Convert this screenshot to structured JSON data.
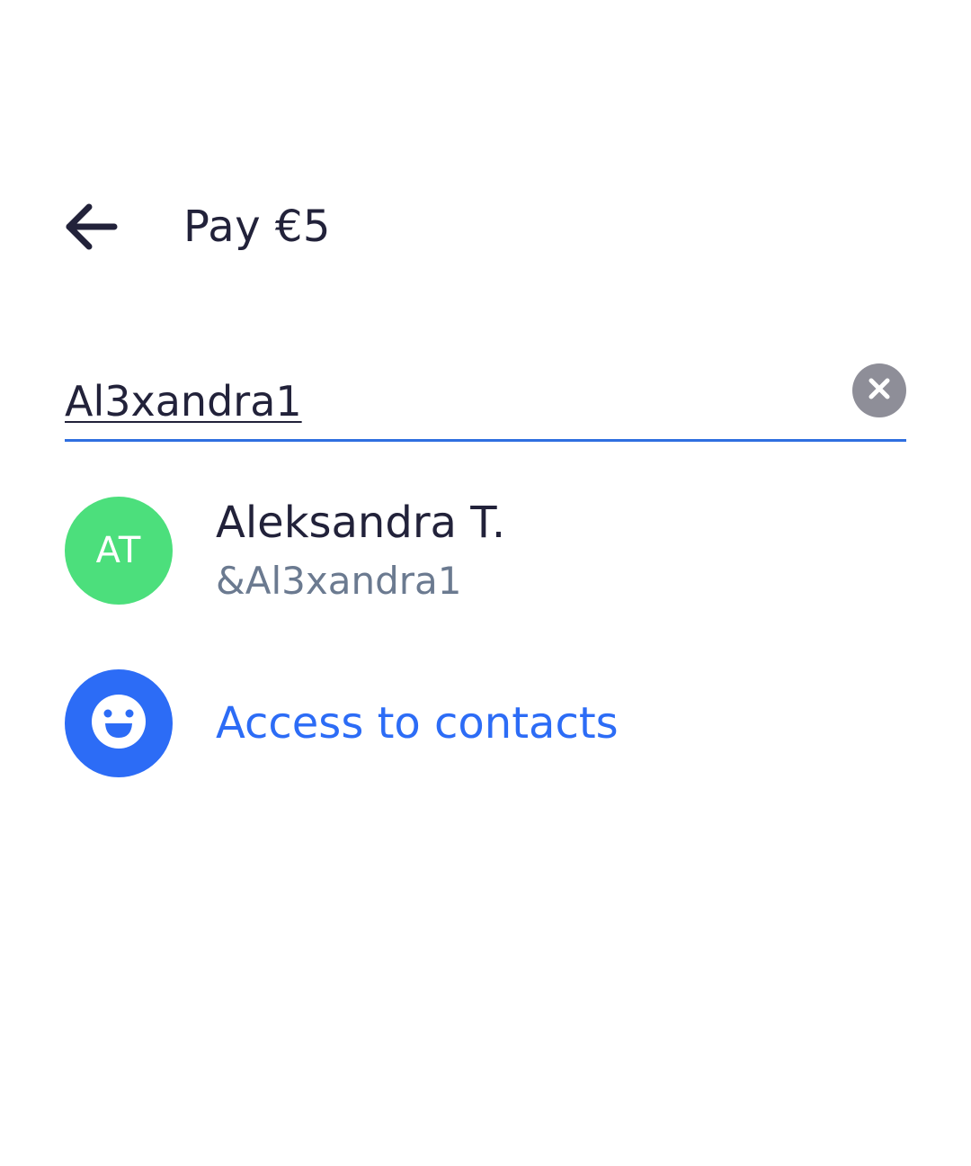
{
  "header": {
    "title": "Pay €5",
    "back_icon": "arrow-left-icon"
  },
  "search": {
    "value": "Al3xandra1",
    "clear_icon": "close-icon"
  },
  "results": [
    {
      "initials": "AT",
      "name": "Aleksandra T.",
      "handle": "&Al3xandra1",
      "avatar_color": "#4cdf7c"
    }
  ],
  "access_contacts": {
    "label": "Access to contacts",
    "icon": "smiley-face-icon",
    "color": "#2c6cf6"
  },
  "colors": {
    "text_primary": "#22223a",
    "text_secondary": "#6b7a90",
    "accent": "#2f6fe0",
    "clear_button": "#8e8e98"
  }
}
